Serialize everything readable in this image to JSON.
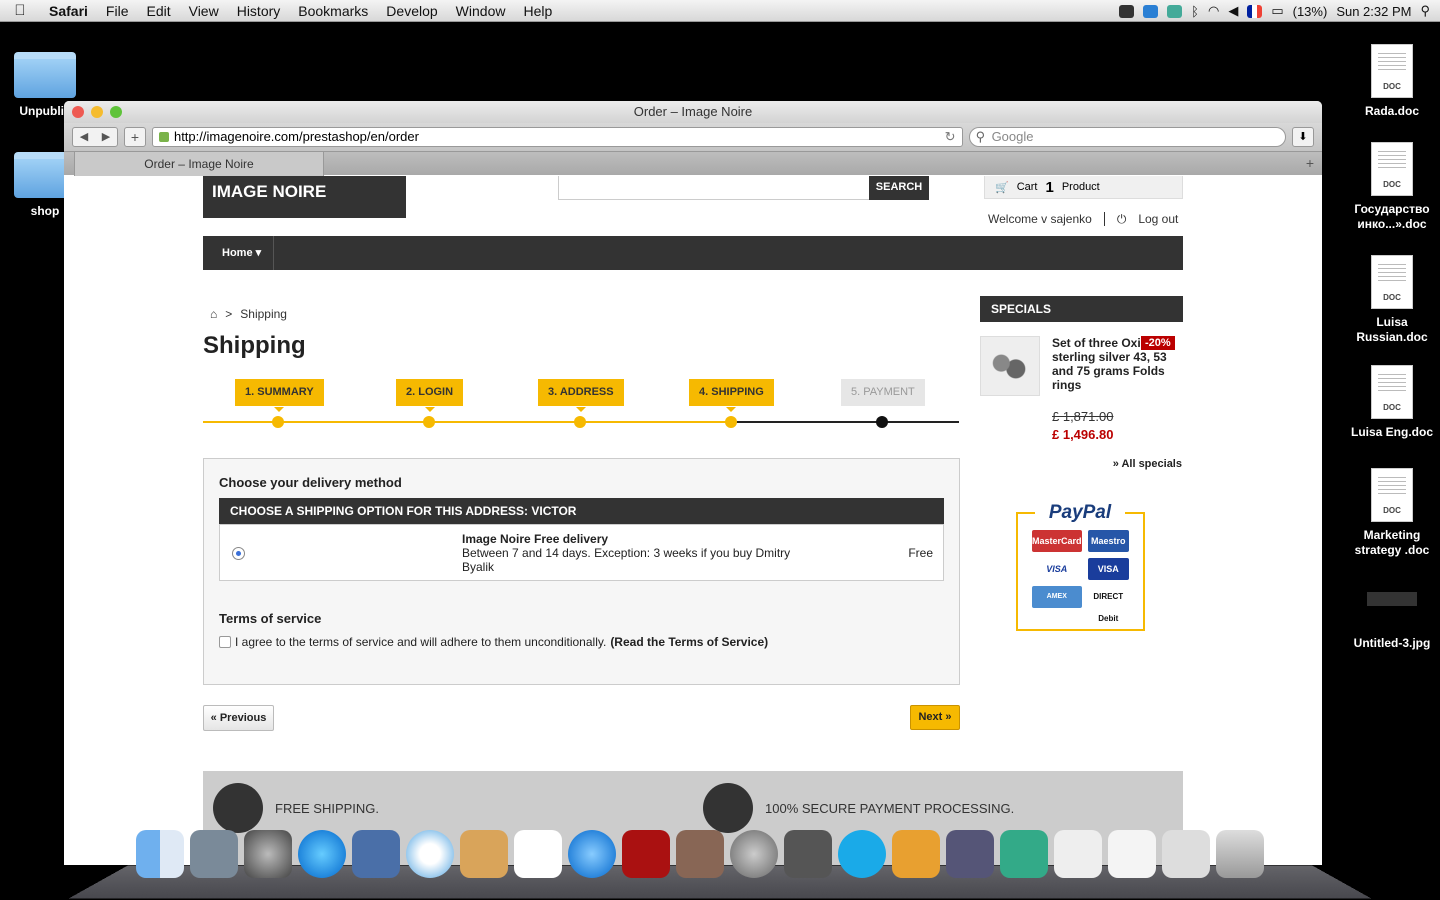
{
  "menubar": {
    "apple": "",
    "app": "Safari",
    "menus": [
      "File",
      "Edit",
      "View",
      "History",
      "Bookmarks",
      "Develop",
      "Window",
      "Help"
    ],
    "battery": "(13%)",
    "clock": "Sun 2:32 PM"
  },
  "desktop": {
    "left": [
      "Unpublis",
      "shop"
    ],
    "right": [
      "Rada.doc",
      "Государство инко...».doc",
      "Luisa Russian.doc",
      "Luisa Eng.doc",
      "Marketing strategy .doc",
      "Untitled-3.jpg"
    ],
    "doc_badge": "DOC"
  },
  "browser": {
    "title": "Order – Image Noire",
    "url": "http://imagenoire.com/prestashop/en/order",
    "search_placeholder": "Google",
    "tab": "Order – Image Noire"
  },
  "site": {
    "logo": "IMAGE NOIRE",
    "search_button": "SEARCH",
    "cart_label": "Cart",
    "cart_count": "1",
    "cart_unit": "Product",
    "welcome": "Welcome v sajenko",
    "logout": "Log out",
    "nav_home": "Home",
    "breadcrumb_sep": ">",
    "breadcrumb_current": "Shipping",
    "page_title": "Shipping"
  },
  "steps": [
    {
      "label": "1. SUMMARY",
      "active": true
    },
    {
      "label": "2. LOGIN",
      "active": true
    },
    {
      "label": "3. ADDRESS",
      "active": true
    },
    {
      "label": "4. SHIPPING",
      "active": true
    },
    {
      "label": "5. PAYMENT",
      "active": false
    }
  ],
  "delivery": {
    "heading": "Choose your delivery method",
    "option_header": "CHOOSE A SHIPPING OPTION FOR THIS ADDRESS: VICTOR",
    "carrier_name": "Image Noire Free delivery",
    "carrier_desc": "Between 7 and 14 days. Exception: 3 weeks if you buy Dmitry Byalik",
    "carrier_price": "Free",
    "tos_heading": "Terms of service",
    "tos_text": "I agree to the terms of service and will adhere to them unconditionally.",
    "tos_link": "(Read the Terms of Service)"
  },
  "buttons": {
    "previous": "« Previous",
    "next": "Next »"
  },
  "specials": {
    "heading": "SPECIALS",
    "product": "Set of three Oxidised sterling silver 43, 53 and 75 grams Folds rings",
    "discount": "-20%",
    "old_price": "£ 1,871.00",
    "new_price": "£ 1,496.80",
    "all_link": "» All specials"
  },
  "paypal": {
    "logo": "PayPal",
    "cards": [
      "MasterCard",
      "Maestro",
      "VISA",
      "VISA",
      "AMEX",
      "DIRECT Debit"
    ]
  },
  "footer": {
    "free_shipping": "FREE SHIPPING.",
    "secure": "100% SECURE PAYMENT PROCESSING."
  },
  "colors": {
    "accent": "#f6b901",
    "dark": "#333333",
    "sale": "#bb0000"
  }
}
